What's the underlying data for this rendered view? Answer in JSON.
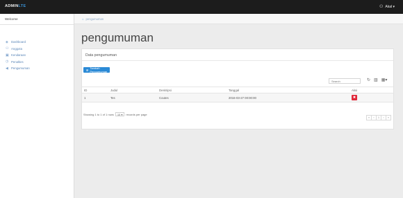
{
  "brand": {
    "name": "ADMIN",
    "suffix": "LTE"
  },
  "user": {
    "label": "Akal ▾",
    "icon": "user-icon"
  },
  "sidebar": {
    "welcome": "Welcome",
    "items": [
      {
        "label": "Dashboard",
        "icon": "dashboard-icon"
      },
      {
        "label": "Anggota",
        "icon": "user-icon"
      },
      {
        "label": "Kendaraan",
        "icon": "vehicle-icon"
      },
      {
        "label": "Penalties",
        "icon": "clock-icon"
      },
      {
        "label": "Pengumuman",
        "icon": "bullhorn-icon"
      }
    ]
  },
  "breadcrumb": {
    "current": "pengumuman",
    "icon": "home-icon"
  },
  "page": {
    "title": "pengumuman"
  },
  "panel": {
    "heading": "Data pengumuman",
    "add_button": "Tambah Pengumuman",
    "search_placeholder": "Search",
    "tools": [
      "refresh-icon",
      "columns-icon",
      "grid-icon"
    ]
  },
  "table": {
    "headers": [
      "ID",
      "Judul",
      "Deskripsi",
      "Tanggal",
      "Aksi"
    ],
    "rows": [
      {
        "id": "1",
        "judul": "Tes",
        "deskripsi": "Coutes",
        "tanggal": "2016-03-27 00:00:00"
      }
    ]
  },
  "footer": {
    "showing": "Showing 1 to 1 of 1 rows",
    "per_page_value": "10 ▾",
    "per_page_suffix": "records per page"
  },
  "pagination": [
    "«",
    "‹",
    "1",
    "›",
    "»"
  ],
  "colors": {
    "accent": "#2b8ad6",
    "danger": "#e0283a",
    "topbar": "#1c1c1c"
  }
}
